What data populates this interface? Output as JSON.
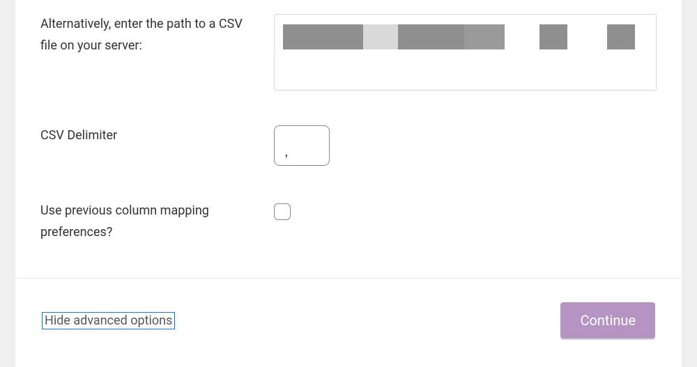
{
  "form": {
    "path": {
      "label": "Alternatively, enter the path to a CSV file on your server:",
      "value": ""
    },
    "delimiter": {
      "label": "CSV Delimiter",
      "value": ","
    },
    "mapping": {
      "label": "Use previous column mapping preferences?",
      "checked": false
    }
  },
  "footer": {
    "toggle_label": "Hide advanced options",
    "continue_label": "Continue"
  }
}
